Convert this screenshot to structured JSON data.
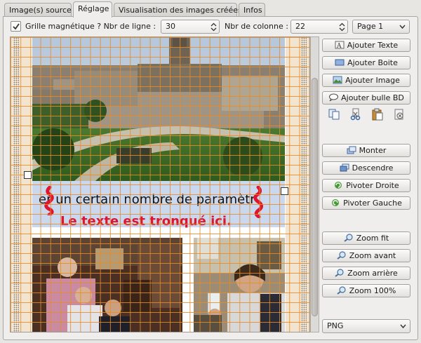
{
  "tabs": [
    {
      "label": "Image(s) source"
    },
    {
      "label": "Réglage"
    },
    {
      "label": "Visualisation des images créées"
    },
    {
      "label": "Infos"
    }
  ],
  "toolbar": {
    "grid_label": "Grille magnétique ? Nbr de ligne :",
    "grid_checked": true,
    "lines_value": "30",
    "columns_label": "Nbr de colonne :",
    "columns_value": "22",
    "page_select": "Page 1"
  },
  "canvas": {
    "text_line1": "er un certain nombre de paramètr",
    "text_line2": "Le texte est tronqué ici.",
    "text_line2_color": "#e0142d",
    "grid_color": "#e68c28",
    "textbox_color": "#c9d7ef"
  },
  "actions": {
    "add_text": "Ajouter Texte",
    "add_box": "Ajouter Boite",
    "add_image": "Ajouter Image",
    "add_bubble": "Ajouter bulle BD",
    "move_up": "Monter",
    "move_down": "Descendre",
    "rotate_right": "Pivoter Droite",
    "rotate_left": "Pivoter Gauche",
    "zoom_fit": "Zoom fit",
    "zoom_in": "Zoom avant",
    "zoom_out": "Zoom arrière",
    "zoom_100": "Zoom 100%"
  },
  "format_select": "PNG"
}
